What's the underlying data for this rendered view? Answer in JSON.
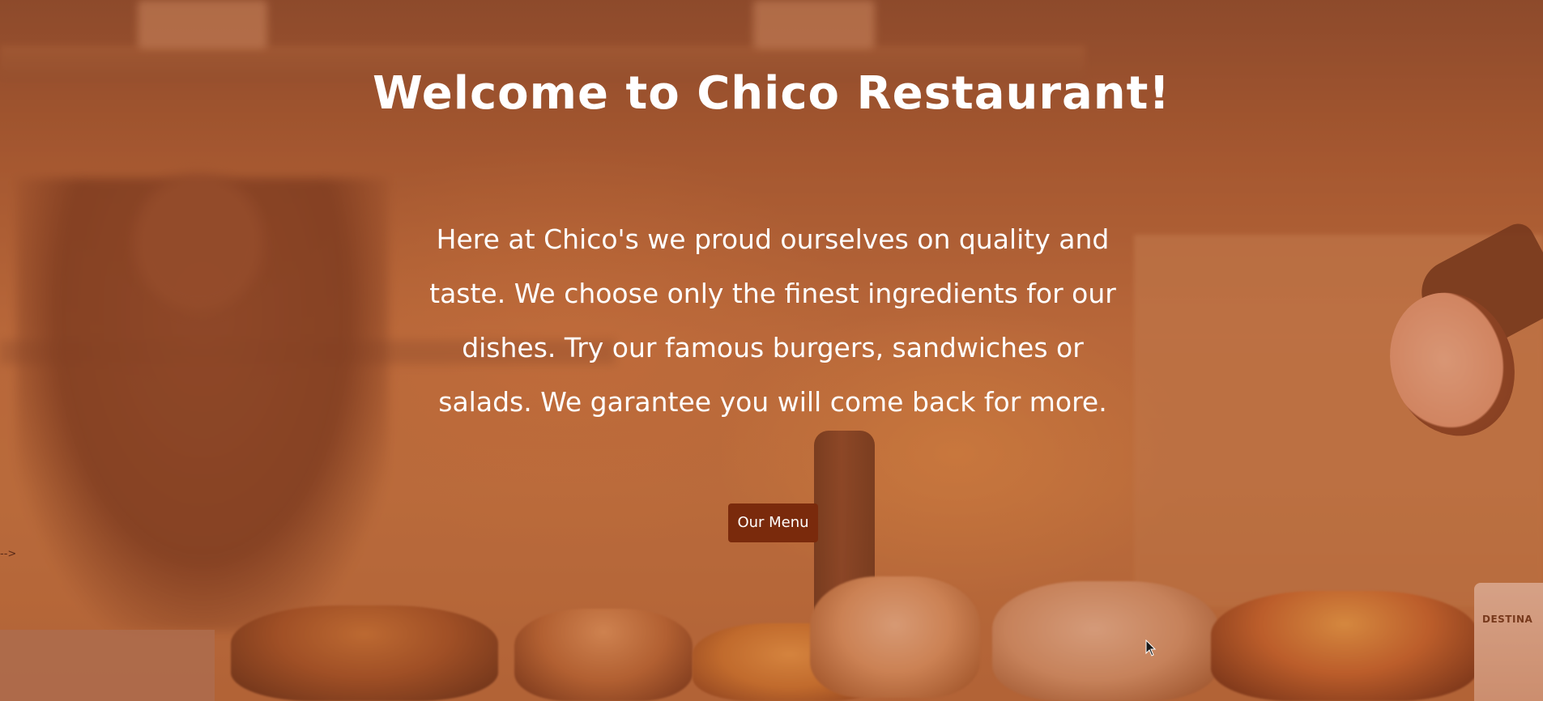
{
  "hero": {
    "title": "Welcome to Chico Restaurant!",
    "intro": "Here at Chico's we proud ourselves on quality and taste. We choose only the finest ingredients for our dishes. Try our famous burgers, sandwiches or salads. We garantee you will come back for more.",
    "menu_button_label": "Our Menu",
    "stray_text": "-->",
    "background_label": "DESTINA"
  },
  "colors": {
    "overlay": "#a85224",
    "button": "#7a2a0c",
    "text": "#ffffff"
  },
  "icons": {
    "cursor": "mouse-pointer-icon"
  }
}
